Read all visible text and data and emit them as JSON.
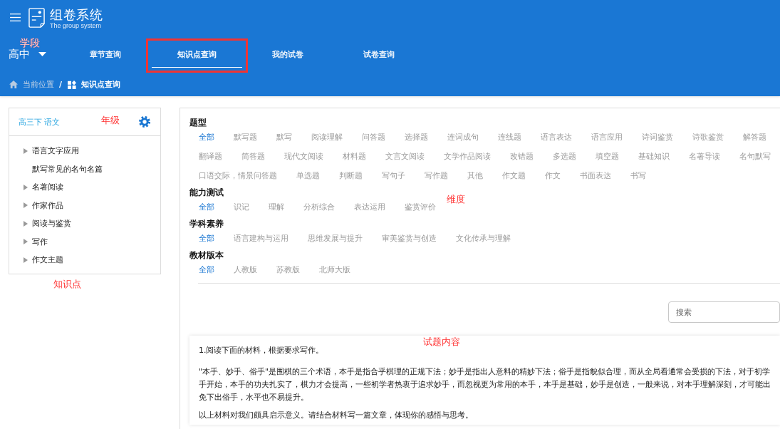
{
  "header": {
    "title": "组卷系统",
    "subtitle": "The group system"
  },
  "stage": {
    "value": "高中",
    "note": "学段"
  },
  "tabs": [
    {
      "label": "章节查询",
      "selected": false,
      "highlighted": false
    },
    {
      "label": "知识点查询",
      "selected": true,
      "highlighted": true
    },
    {
      "label": "我的试卷",
      "selected": false,
      "highlighted": false
    },
    {
      "label": "试卷查询",
      "selected": false,
      "highlighted": false
    }
  ],
  "breadcrumb": {
    "root": "当前位置",
    "separator": "/",
    "current": "知识点查询"
  },
  "sidebar": {
    "title": "高三下 语文",
    "note": "年级",
    "items": [
      {
        "label": "语言文字应用",
        "expandable": true,
        "expanded": false
      },
      {
        "label": "默写常见的名句名篇",
        "expandable": false
      },
      {
        "label": "名著阅读",
        "expandable": true,
        "expanded": false
      },
      {
        "label": "作家作品",
        "expandable": true,
        "expanded": false
      },
      {
        "label": "阅读与鉴赏",
        "expandable": true,
        "expanded": false
      },
      {
        "label": "写作",
        "expandable": true,
        "expanded": false
      },
      {
        "label": "作文主题",
        "expandable": true,
        "expanded": false
      }
    ],
    "caption": "知识点"
  },
  "filters": [
    {
      "label": "题型",
      "options": [
        {
          "label": "全部",
          "selected": true
        },
        {
          "label": "默写题",
          "selected": false
        },
        {
          "label": "默写",
          "selected": false
        },
        {
          "label": "阅读理解",
          "selected": false
        },
        {
          "label": "问答题",
          "selected": false
        },
        {
          "label": "选择题",
          "selected": false
        },
        {
          "label": "连词成句",
          "selected": false
        },
        {
          "label": "连线题",
          "selected": false
        },
        {
          "label": "语言表达",
          "selected": false
        },
        {
          "label": "语言应用",
          "selected": false
        },
        {
          "label": "诗词鉴赏",
          "selected": false
        },
        {
          "label": "诗歌鉴赏",
          "selected": false
        },
        {
          "label": "解答题",
          "selected": false
        },
        {
          "label": "翻译题",
          "selected": false
        },
        {
          "label": "简答题",
          "selected": false
        },
        {
          "label": "现代文阅读",
          "selected": false
        },
        {
          "label": "材料题",
          "selected": false
        },
        {
          "label": "文言文阅读",
          "selected": false
        },
        {
          "label": "文学作品阅读",
          "selected": false
        },
        {
          "label": "改错题",
          "selected": false
        },
        {
          "label": "多选题",
          "selected": false
        },
        {
          "label": "填空题",
          "selected": false
        },
        {
          "label": "基础知识",
          "selected": false
        },
        {
          "label": "名著导读",
          "selected": false
        },
        {
          "label": "名句默写",
          "selected": false
        },
        {
          "label": "口语交际，情景问答题",
          "selected": false
        },
        {
          "label": "单选题",
          "selected": false
        },
        {
          "label": "判断题",
          "selected": false
        },
        {
          "label": "写句子",
          "selected": false
        },
        {
          "label": "写作题",
          "selected": false
        },
        {
          "label": "其他",
          "selected": false
        },
        {
          "label": "作文题",
          "selected": false
        },
        {
          "label": "作文",
          "selected": false
        },
        {
          "label": "书面表达",
          "selected": false
        },
        {
          "label": "书写",
          "selected": false
        }
      ]
    },
    {
      "label": "能力测试",
      "note": "维度",
      "options": [
        {
          "label": "全部",
          "selected": true
        },
        {
          "label": "识记",
          "selected": false
        },
        {
          "label": "理解",
          "selected": false
        },
        {
          "label": "分析综合",
          "selected": false
        },
        {
          "label": "表达运用",
          "selected": false
        },
        {
          "label": "鉴赏评价",
          "selected": false
        }
      ]
    },
    {
      "label": "学科素养",
      "options": [
        {
          "label": "全部",
          "selected": true
        },
        {
          "label": "语言建构与运用",
          "selected": false
        },
        {
          "label": "思维发展与提升",
          "selected": false
        },
        {
          "label": "审美鉴赏与创造",
          "selected": false
        },
        {
          "label": "文化传承与理解",
          "selected": false
        }
      ]
    },
    {
      "label": "教材版本",
      "options": [
        {
          "label": "全部",
          "selected": true
        },
        {
          "label": "人教版",
          "selected": false
        },
        {
          "label": "苏教版",
          "selected": false
        },
        {
          "label": "北师大版",
          "selected": false
        }
      ]
    }
  ],
  "search": {
    "placeholder": "搜索"
  },
  "question": {
    "note": "试题内容",
    "title": "1.阅读下面的材料，根据要求写作。",
    "paragraph_lines": [
      "\"本手、妙手、俗手\"是围棋的三个术语，本手是指合乎棋理的正规下法；妙手是指出人意料的精妙下法；俗手是指貌似合理，而从全局看通常会受损的下法，对于初学",
      "手开始，本手的功夫扎实了，棋力才会提高，一些初学者热衷于追求妙手，而忽视更为常用的本手，本手是基础，妙手是创造，一般来说，对本手理解深刻，才可能出",
      "免下出俗手，水平也不易提升。"
    ],
    "closing": "以上材料对我们颇具启示意义。请结合材料写一篇文章，体现你的感悟与思考。"
  }
}
